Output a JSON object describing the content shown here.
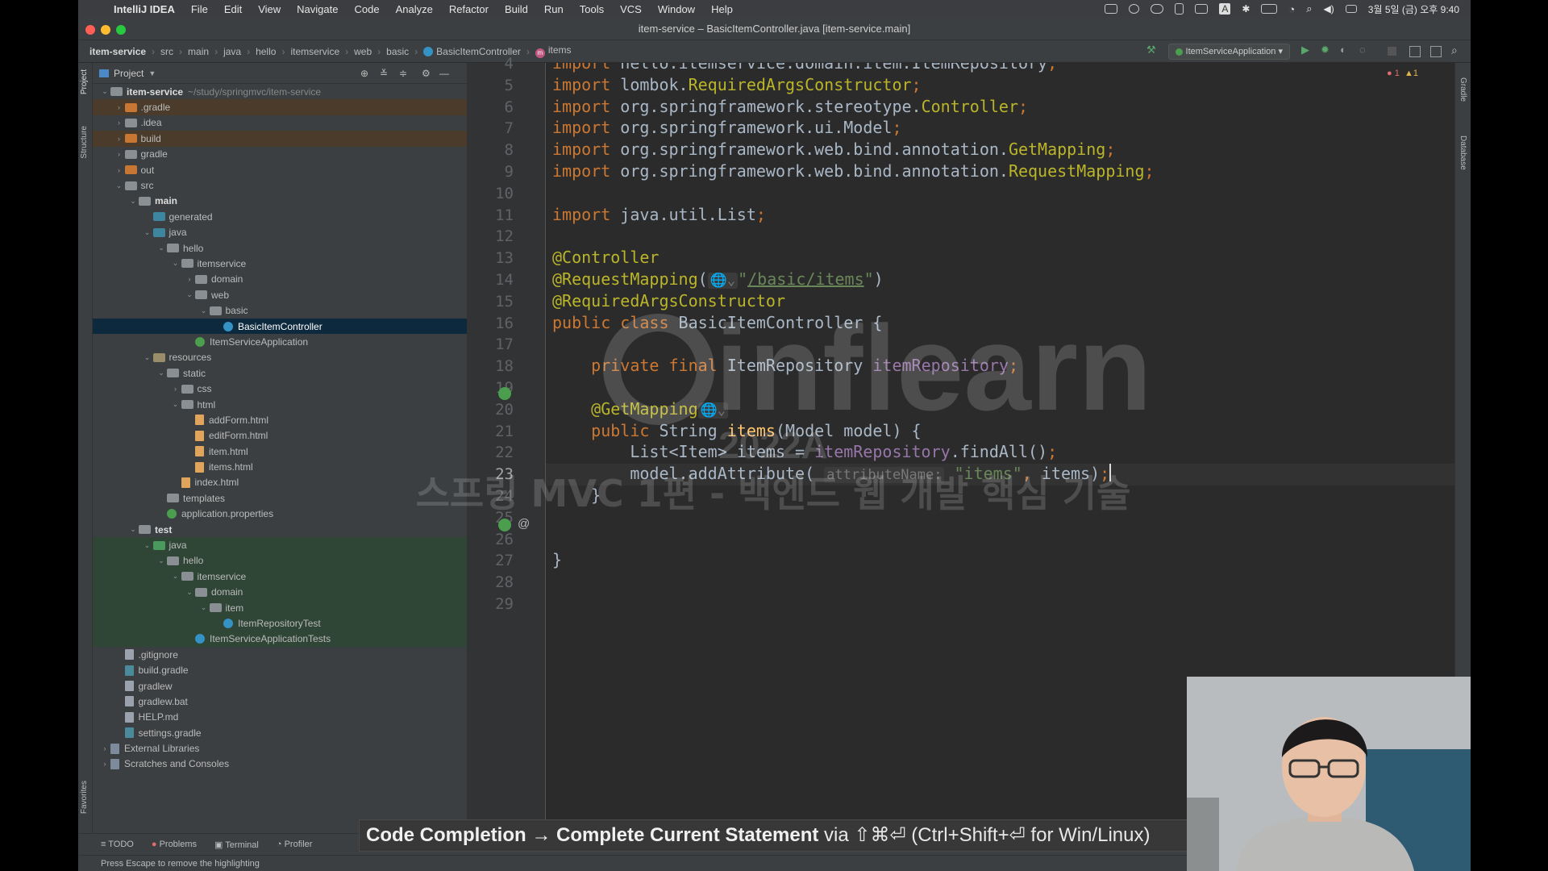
{
  "menubar": {
    "app_name": "IntelliJ IDEA",
    "items": [
      "File",
      "Edit",
      "View",
      "Navigate",
      "Code",
      "Analyze",
      "Refactor",
      "Build",
      "Run",
      "Tools",
      "VCS",
      "Window",
      "Help"
    ],
    "clock": "3월 5일 (금) 오후 9:40"
  },
  "window": {
    "title": "item-service – BasicItemController.java [item-service.main]"
  },
  "breadcrumb": [
    "item-service",
    "src",
    "main",
    "java",
    "hello",
    "itemservice",
    "web",
    "basic",
    "BasicItemController",
    "items"
  ],
  "toolbar": {
    "run_config": "ItemServiceApplication",
    "inspection_errors": "1",
    "inspection_warnings": "1"
  },
  "left_strip": {
    "project": "Project",
    "structure": "Structure",
    "favorites": "Favorites"
  },
  "right_strip": {
    "gradle": "Gradle",
    "database": "Database"
  },
  "project_panel": {
    "title": "Project",
    "tree": [
      {
        "label": "item-service",
        "extra": "~/study/springmvc/item-service",
        "depth": 0,
        "arrow": "open",
        "icon": "module",
        "bold": true
      },
      {
        "label": ".gradle",
        "depth": 1,
        "arrow": "closed",
        "icon": "exc",
        "bg": "excl"
      },
      {
        "label": ".idea",
        "depth": 1,
        "arrow": "closed",
        "icon": "plain"
      },
      {
        "label": "build",
        "depth": 1,
        "arrow": "closed",
        "icon": "exc",
        "bg": "excl"
      },
      {
        "label": "gradle",
        "depth": 1,
        "arrow": "closed",
        "icon": "plain"
      },
      {
        "label": "out",
        "depth": 1,
        "arrow": "closed",
        "icon": "exc"
      },
      {
        "label": "src",
        "depth": 1,
        "arrow": "open",
        "icon": "plain"
      },
      {
        "label": "main",
        "depth": 2,
        "arrow": "open",
        "icon": "plain",
        "bold": true
      },
      {
        "label": "generated",
        "depth": 3,
        "arrow": "none",
        "icon": "src"
      },
      {
        "label": "java",
        "depth": 3,
        "arrow": "open",
        "icon": "src"
      },
      {
        "label": "hello",
        "depth": 4,
        "arrow": "open",
        "icon": "plain"
      },
      {
        "label": "itemservice",
        "depth": 5,
        "arrow": "open",
        "icon": "plain"
      },
      {
        "label": "domain",
        "depth": 6,
        "arrow": "closed",
        "icon": "plain"
      },
      {
        "label": "web",
        "depth": 6,
        "arrow": "open",
        "icon": "plain"
      },
      {
        "label": "basic",
        "depth": 7,
        "arrow": "open",
        "icon": "plain"
      },
      {
        "label": "BasicItemController",
        "depth": 8,
        "arrow": "none",
        "icon": "cls",
        "selected": true
      },
      {
        "label": "ItemServiceApplication",
        "depth": 6,
        "arrow": "none",
        "icon": "leaf"
      },
      {
        "label": "resources",
        "depth": 3,
        "arrow": "open",
        "icon": "res"
      },
      {
        "label": "static",
        "depth": 4,
        "arrow": "open",
        "icon": "plain"
      },
      {
        "label": "css",
        "depth": 5,
        "arrow": "closed",
        "icon": "plain"
      },
      {
        "label": "html",
        "depth": 5,
        "arrow": "open",
        "icon": "plain"
      },
      {
        "label": "addForm.html",
        "depth": 6,
        "arrow": "none",
        "icon": "html"
      },
      {
        "label": "editForm.html",
        "depth": 6,
        "arrow": "none",
        "icon": "html"
      },
      {
        "label": "item.html",
        "depth": 6,
        "arrow": "none",
        "icon": "html"
      },
      {
        "label": "items.html",
        "depth": 6,
        "arrow": "none",
        "icon": "html"
      },
      {
        "label": "index.html",
        "depth": 5,
        "arrow": "none",
        "icon": "html"
      },
      {
        "label": "templates",
        "depth": 4,
        "arrow": "none",
        "icon": "plain"
      },
      {
        "label": "application.properties",
        "depth": 4,
        "arrow": "none",
        "icon": "leaf"
      },
      {
        "label": "test",
        "depth": 2,
        "arrow": "open",
        "icon": "plain",
        "bold": true
      },
      {
        "label": "java",
        "depth": 3,
        "arrow": "open",
        "icon": "test",
        "bg": "testbg"
      },
      {
        "label": "hello",
        "depth": 4,
        "arrow": "open",
        "icon": "plain",
        "bg": "testbg"
      },
      {
        "label": "itemservice",
        "depth": 5,
        "arrow": "open",
        "icon": "plain",
        "bg": "testbg"
      },
      {
        "label": "domain",
        "depth": 6,
        "arrow": "open",
        "icon": "plain",
        "bg": "testbg"
      },
      {
        "label": "item",
        "depth": 7,
        "arrow": "open",
        "icon": "plain",
        "bg": "testbg"
      },
      {
        "label": "ItemRepositoryTest",
        "depth": 8,
        "arrow": "none",
        "icon": "cls",
        "bg": "testbg"
      },
      {
        "label": "ItemServiceApplicationTests",
        "depth": 6,
        "arrow": "none",
        "icon": "cls",
        "bg": "testbg"
      },
      {
        "label": ".gitignore",
        "depth": 1,
        "arrow": "none",
        "icon": "gen"
      },
      {
        "label": "build.gradle",
        "depth": 1,
        "arrow": "none",
        "icon": "gradle"
      },
      {
        "label": "gradlew",
        "depth": 1,
        "arrow": "none",
        "icon": "gen"
      },
      {
        "label": "gradlew.bat",
        "depth": 1,
        "arrow": "none",
        "icon": "gen"
      },
      {
        "label": "HELP.md",
        "depth": 1,
        "arrow": "none",
        "icon": "gen"
      },
      {
        "label": "settings.gradle",
        "depth": 1,
        "arrow": "none",
        "icon": "gradle"
      },
      {
        "label": "External Libraries",
        "depth": 0,
        "arrow": "closed",
        "icon": "lib"
      },
      {
        "label": "Scratches and Consoles",
        "depth": 0,
        "arrow": "closed",
        "icon": "lib"
      }
    ]
  },
  "editor": {
    "current_line": 23,
    "lines": [
      {
        "n": 4,
        "t": [
          [
            "kw",
            "import "
          ],
          [
            "",
            "hello.itemservice.domain.item.ItemRepository"
          ],
          [
            "kw",
            ";"
          ]
        ]
      },
      {
        "n": 5,
        "t": [
          [
            "kw",
            "import "
          ],
          [
            "",
            "lombok."
          ],
          [
            "ann",
            "RequiredArgsConstructor"
          ],
          [
            "kw",
            ";"
          ]
        ]
      },
      {
        "n": 6,
        "t": [
          [
            "kw",
            "import "
          ],
          [
            "",
            "org.springframework.stereotype."
          ],
          [
            "ann",
            "Controller"
          ],
          [
            "kw",
            ";"
          ]
        ]
      },
      {
        "n": 7,
        "t": [
          [
            "kw",
            "import "
          ],
          [
            "",
            "org.springframework.ui.Model"
          ],
          [
            "kw",
            ";"
          ]
        ]
      },
      {
        "n": 8,
        "t": [
          [
            "kw",
            "import "
          ],
          [
            "",
            "org.springframework.web.bind.annotation."
          ],
          [
            "ann",
            "GetMapping"
          ],
          [
            "kw",
            ";"
          ]
        ]
      },
      {
        "n": 9,
        "t": [
          [
            "kw",
            "import "
          ],
          [
            "",
            "org.springframework.web.bind.annotation."
          ],
          [
            "ann",
            "RequestMapping"
          ],
          [
            "kw",
            ";"
          ]
        ]
      },
      {
        "n": 10,
        "t": []
      },
      {
        "n": 11,
        "t": [
          [
            "kw",
            "import "
          ],
          [
            "",
            "java.util.List"
          ],
          [
            "kw",
            ";"
          ]
        ]
      },
      {
        "n": 12,
        "t": []
      },
      {
        "n": 13,
        "t": [
          [
            "ann",
            "@Controller"
          ]
        ]
      },
      {
        "n": 14,
        "t": [
          [
            "ann",
            "@RequestMapping"
          ],
          [
            "",
            "("
          ],
          [
            "hint",
            "🌐⌄"
          ],
          [
            "str",
            "\""
          ],
          [
            "str link",
            "/basic/items"
          ],
          [
            "str",
            "\""
          ],
          [
            "",
            ")"
          ]
        ]
      },
      {
        "n": 15,
        "t": [
          [
            "ann",
            "@RequiredArgsConstructor"
          ]
        ]
      },
      {
        "n": 16,
        "t": [
          [
            "kw",
            "public class "
          ],
          [
            "",
            "BasicItemController {"
          ]
        ]
      },
      {
        "n": 17,
        "t": []
      },
      {
        "n": 18,
        "t": [
          [
            "",
            "    "
          ],
          [
            "kw",
            "private final "
          ],
          [
            "",
            "ItemRepository "
          ],
          [
            "fld",
            "itemRepository"
          ],
          [
            "kw",
            ";"
          ]
        ]
      },
      {
        "n": 19,
        "t": []
      },
      {
        "n": 20,
        "t": [
          [
            "",
            "    "
          ],
          [
            "ann",
            "@GetMapping"
          ],
          [
            "hint",
            "🌐⌄"
          ]
        ]
      },
      {
        "n": 21,
        "t": [
          [
            "",
            "    "
          ],
          [
            "kw",
            "public "
          ],
          [
            "",
            "String "
          ],
          [
            "fn",
            "items"
          ],
          [
            "",
            "(Model model) {"
          ]
        ]
      },
      {
        "n": 22,
        "t": [
          [
            "",
            "        List<Item> items = "
          ],
          [
            "fld",
            "itemRepository"
          ],
          [
            "",
            ".findAll()"
          ],
          [
            "kw",
            ";"
          ]
        ]
      },
      {
        "n": 23,
        "t": [
          [
            "",
            "        model.addAttribute( "
          ],
          [
            "hint",
            "attributeName:"
          ],
          [
            "str",
            " \"items\""
          ],
          [
            "kw",
            ", "
          ],
          [
            "",
            "items)"
          ],
          [
            "kw",
            ";"
          ]
        ]
      },
      {
        "n": 24,
        "t": [
          [
            "",
            "    }"
          ]
        ]
      },
      {
        "n": 25,
        "t": []
      },
      {
        "n": 26,
        "t": []
      },
      {
        "n": 27,
        "t": [
          [
            "",
            "}"
          ]
        ]
      },
      {
        "n": 28,
        "t": []
      },
      {
        "n": 29,
        "t": []
      }
    ]
  },
  "watermark": {
    "brand": "inflearn",
    "year": "2022A",
    "course": "스프링 MVC 1편 - 백엔드 웹 개발 핵심 기술"
  },
  "tip": {
    "bold": "Code Completion → Complete Current Statement",
    "rest": " via ⇧⌘⏎ (Ctrl+Shift+⏎ for Win/Linux)"
  },
  "bottom_tools": [
    "TODO",
    "Problems",
    "Terminal",
    "Profiler"
  ],
  "status": "Press Escape to remove the highlighting"
}
